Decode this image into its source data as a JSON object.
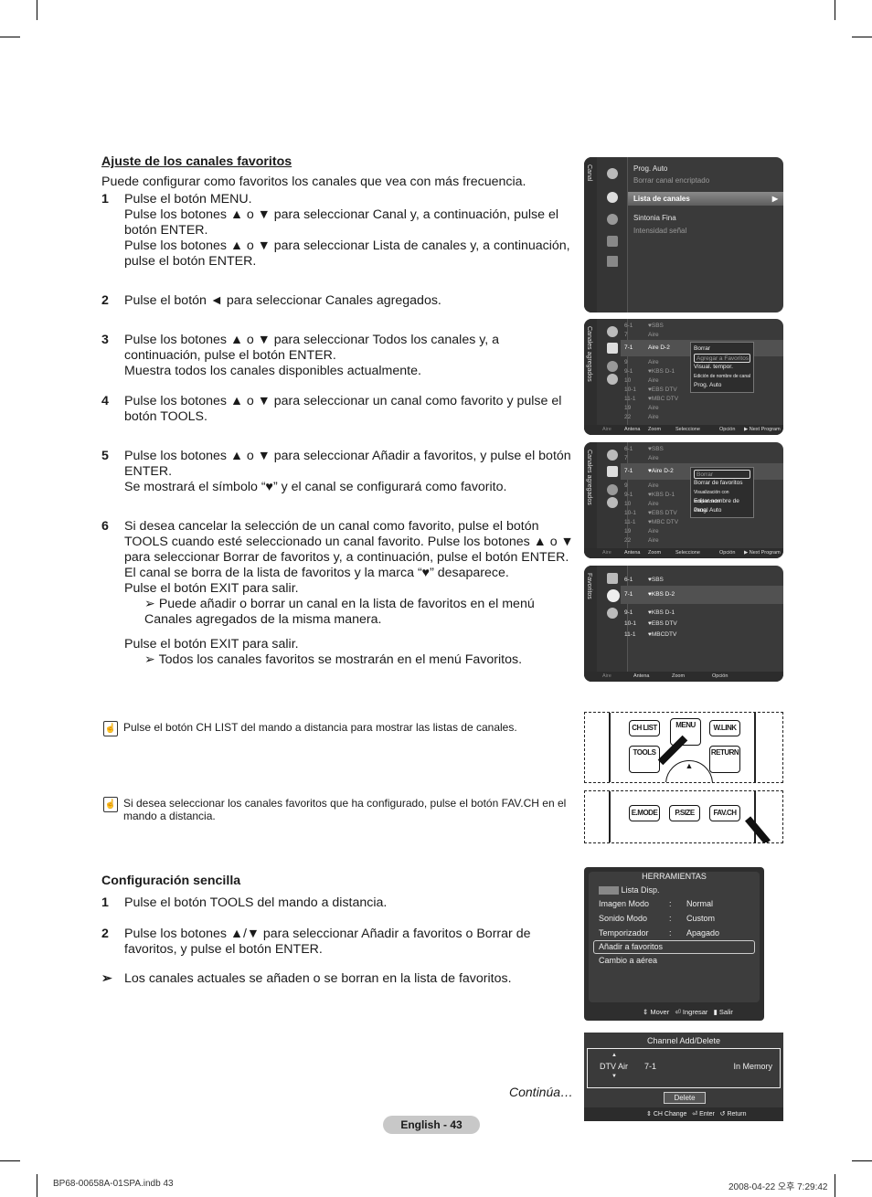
{
  "section1": {
    "title": "Ajuste de los canales favoritos",
    "intro": "Puede configurar como favoritos los canales que vea con más frecuencia.",
    "steps": [
      {
        "num": "1",
        "lines": [
          "Pulse el botón MENU.",
          "Pulse los botones ▲ o ▼ para seleccionar Canal y, a continuación, pulse el botón ENTER.",
          "Pulse los botones ▲ o ▼ para seleccionar Lista de canales y, a continuación, pulse el botón ENTER."
        ]
      },
      {
        "num": "2",
        "lines": [
          "Pulse el botón ◄ para seleccionar Canales agregados."
        ]
      },
      {
        "num": "3",
        "lines": [
          "Pulse los botones ▲ o ▼ para seleccionar Todos los canales y, a continuación, pulse el botón ENTER.",
          "Muestra todos los canales disponibles actualmente."
        ]
      },
      {
        "num": "4",
        "lines": [
          "Pulse los botones ▲ o ▼ para seleccionar un canal como favorito y pulse el botón TOOLS."
        ]
      },
      {
        "num": "5",
        "lines": [
          "Pulse los botones ▲ o ▼ para seleccionar Añadir a favoritos, y pulse el botón ENTER.",
          "Se mostrará el símbolo “♥” y el canal se configurará como favorito."
        ]
      },
      {
        "num": "6",
        "lines": [
          "Si desea cancelar la selección de un canal como favorito, pulse el botón TOOLS cuando esté seleccionado un canal favorito. Pulse los botones ▲ o ▼ para seleccionar Borrar de favoritos y, a continuación, pulse el botón ENTER. El canal se borra de la lista de favoritos y la marca “♥” desaparece.",
          "Pulse el botón EXIT para salir.",
          "➢ Puede añadir o borrar un canal en la lista de favoritos en el menú Canales agregados de la misma manera.",
          "Pulse el botón EXIT para salir.",
          "➢ Todos los canales favoritos se mostrarán en el menú Favoritos."
        ]
      }
    ]
  },
  "notes": [
    "Pulse el botón CH LIST del mando a distancia para mostrar las listas de canales.",
    "Si desea seleccionar los canales favoritos que ha configurado, pulse el botón FAV.CH en el mando a distancia."
  ],
  "section2": {
    "title": "Configuración sencilla",
    "steps": [
      {
        "num": "1",
        "text": "Pulse el botón TOOLS del mando a distancia."
      },
      {
        "num": "2",
        "text": "Pulse los botones ▲/▼ para seleccionar Añadir a favoritos o Borrar de favoritos, y pulse el botón ENTER."
      }
    ],
    "tip": "Los canales actuales se añaden o se borran en la lista de favoritos."
  },
  "continua": "Continúa…",
  "page_label": "English - 43",
  "print_footer": {
    "left": "BP68-00658A-01SPA.indb   43",
    "right": "2008-04-22   오후 7:29:42"
  },
  "screen_canal": {
    "side_label": "Canal",
    "items": [
      {
        "label": "Prog. Auto",
        "dim": false
      },
      {
        "label": "Borrar canal encriptado",
        "dim": true
      },
      {
        "label": "Lista de canales",
        "dim": false,
        "selected": true,
        "arrow": "▶"
      },
      {
        "label": "Sintonia Fina",
        "dim": false
      },
      {
        "label": "Intensidad señal",
        "dim": true
      }
    ]
  },
  "screen_added1": {
    "side_label": "Canales agregados",
    "channels": [
      {
        "num": "6-1",
        "name": "♥SBS"
      },
      {
        "num": "7",
        "name": "Aire"
      },
      {
        "num": "7-1",
        "name": "Aire D-2",
        "selected": true
      },
      {
        "num": "9",
        "name": "Aire"
      },
      {
        "num": "9-1",
        "name": "♥KBS D-1"
      },
      {
        "num": "10",
        "name": "Aire"
      },
      {
        "num": "10-1",
        "name": "♥EBS DTV"
      },
      {
        "num": "11-1",
        "name": "♥MBC DTV"
      },
      {
        "num": "19",
        "name": "Aire"
      },
      {
        "num": "22",
        "name": "Aire"
      }
    ],
    "popup": [
      "Borrar",
      "Agregar a Favoritos",
      "Visual. tempor.",
      "Edición de nombre de canal",
      "Prog. Auto"
    ],
    "popup_selected": 1,
    "footer": [
      "Aire",
      "Antena",
      "Zoom",
      "Seleccione",
      "Opción",
      "▶ Next Program"
    ]
  },
  "screen_added2": {
    "side_label": "Canales agregados",
    "channels": [
      {
        "num": "6-1",
        "name": "♥SBS"
      },
      {
        "num": "7",
        "name": "Aire"
      },
      {
        "num": "7-1",
        "name": "♥Aire D-2",
        "selected": true
      },
      {
        "num": "9",
        "name": "Aire"
      },
      {
        "num": "9-1",
        "name": "♥KBS D-1"
      },
      {
        "num": "10",
        "name": "Aire"
      },
      {
        "num": "10-1",
        "name": "♥EBS DTV"
      },
      {
        "num": "11-1",
        "name": "♥MBC DTV"
      },
      {
        "num": "19",
        "name": "Aire"
      },
      {
        "num": "22",
        "name": "Aire"
      }
    ],
    "popup": [
      "Borrar",
      "Borrar de favoritos",
      "Visualización con temporizador",
      "Editar nombre de canal",
      "Prog. Auto"
    ],
    "popup_selected": 0,
    "footer": [
      "Aire",
      "Antena",
      "Zoom",
      "Seleccione",
      "Opción",
      "▶ Next Program"
    ]
  },
  "screen_fav": {
    "side_label": "Favoritos",
    "channels": [
      {
        "num": "6-1",
        "name": "♥SBS"
      },
      {
        "num": "7-1",
        "name": "♥KBS D-2",
        "selected": true
      },
      {
        "num": "9-1",
        "name": "♥KBS D-1"
      },
      {
        "num": "10-1",
        "name": "♥EBS DTV"
      },
      {
        "num": "11-1",
        "name": "♥MBCDTV"
      }
    ],
    "footer": [
      "Aire",
      "Antena",
      "Zoom",
      "Opción"
    ]
  },
  "remote1": {
    "buttons": [
      "CH LIST",
      "MENU",
      "W.LINK",
      "TOOLS",
      "RETURN"
    ]
  },
  "remote2": {
    "buttons": [
      "E.MODE",
      "P.SIZE",
      "FAV.CH"
    ]
  },
  "tools_menu": {
    "title": "HERRAMIENTAS",
    "anynet": "Lista Disp.",
    "rows": [
      {
        "label": "Imagen Modo",
        "sep": ":",
        "value": "Normal"
      },
      {
        "label": "Sonido Modo",
        "sep": ":",
        "value": "Custom"
      },
      {
        "label": "Temporizador",
        "sep": ":",
        "value": "Apagado"
      }
    ],
    "items": [
      "Añadir a favoritos",
      "Cambio a aérea"
    ],
    "footer": [
      "Mover",
      "Ingresar",
      "Salir"
    ]
  },
  "ch_add_delete": {
    "title": "Channel Add/Delete",
    "source": "DTV Air",
    "channel": "7-1",
    "status": "In Memory",
    "button": "Delete",
    "footer": [
      "CH Change",
      "Enter",
      "Return"
    ]
  }
}
